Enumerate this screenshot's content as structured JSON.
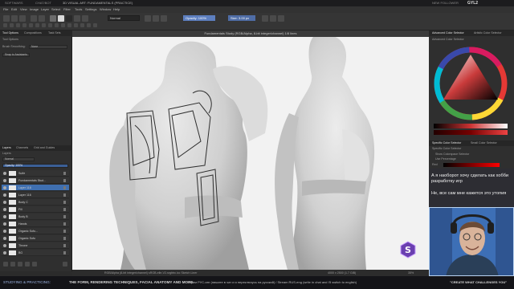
{
  "stream_bar": {
    "channel": "SOFTWARS",
    "chat_tab": "CHAT/BOT",
    "stream_title": "3D VISUAL ART: FUNDAMENTALS (PRACTICE)",
    "follower_label": "NEW FOLLOWER",
    "follower_count": "GYL2"
  },
  "menu": [
    "File",
    "Edit",
    "View",
    "Image",
    "Layer",
    "Select",
    "Filter",
    "Tools",
    "Settings",
    "Window",
    "Help"
  ],
  "toolbar": {
    "blend_mode": "Normal",
    "opacity_label": "Opacity: 100%",
    "size_label": "Size: 3.00 px"
  },
  "left_dock": {
    "top_tabs": [
      "Tool Options",
      "Compositions",
      "Task Sets"
    ],
    "tool_options_header": "Tool Options",
    "smoothing_label": "Brush Smoothing:",
    "smoothing_value": "None",
    "snap_label": "Snap to Assistants",
    "layer_tabs": [
      "Layers",
      "Channels",
      "Grid and Guides"
    ],
    "layers_header": "Layers",
    "blend_mode": "Normal",
    "opacity": "Opacity: 100%",
    "layers": [
      {
        "name": "Sulfe",
        "selected": false
      },
      {
        "name": "Fundamentals Stud...",
        "selected": false
      },
      {
        "name": "Layer 118",
        "selected": true
      },
      {
        "name": "Layer 116",
        "selected": false
      },
      {
        "name": "Body C",
        "selected": false
      },
      {
        "name": "Fill",
        "selected": false
      },
      {
        "name": "Body B",
        "selected": false
      },
      {
        "name": "Hands",
        "selected": false
      },
      {
        "name": "Organic Sofo...",
        "selected": false
      },
      {
        "name": "Organic Sofo",
        "selected": false
      },
      {
        "name": "Throne",
        "selected": false
      },
      {
        "name": "BG",
        "selected": false
      }
    ]
  },
  "canvas": {
    "title": "Fundamentals Study (RGB/Alpha, 8-bit integer/channel) 1/8 lines",
    "status": "RGB/Alpha (8-bit integer/channel) sRGB-elle-V2-srgbtrc.icc   Sketch Liner",
    "status_right": "4000 x 2500 (1.7 GiB)",
    "zoom": "35%"
  },
  "right_dock": {
    "tabs": [
      "Advanced Color Selector",
      "Artistic Color Selector"
    ],
    "panel_title": "Advanced Color Selector",
    "specific_color_tabs": [
      "Specific Color Selector",
      "Small Color Selector"
    ],
    "specific_color_header": "Specific Color Selector",
    "show_colorspace": "Show Colorspace Selector",
    "use_percentage": "Use Percentage",
    "channel_label": "Red"
  },
  "chat": [
    {
      "text": "А я наоборот хочу сделать как хобби разработку игр"
    },
    {
      "text": "Не, все сам мне кажется это утопия"
    }
  ],
  "ticker": {
    "item1": "STUDYING & PRACTICING:",
    "item2": "THE FORM, RENDERING TECHNIQUES, FACIAL ANATOMY AND MORE",
    "item3": "стрим РУС-инг (пишите в чат и я переключусь на русский) / Stream RUS-eng (write in chat and I'll switch to english)",
    "item4": "\"CREATE WHAT CHALLENGES YOU\""
  },
  "colors": {
    "accent": "#3f6fb0",
    "panel": "#2f2f2f",
    "canvas": "#f2f2f2",
    "webcam_bg": "#3e6fb8"
  }
}
